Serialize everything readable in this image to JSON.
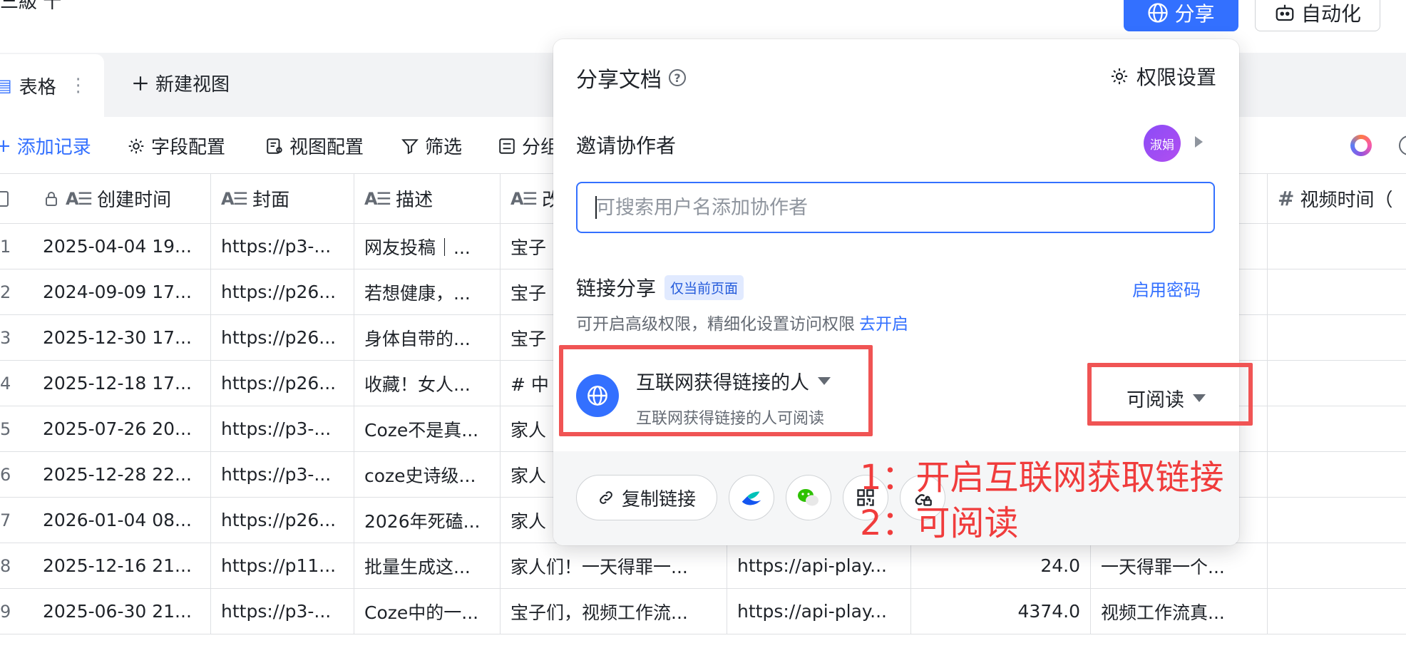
{
  "topbar": {
    "title_fragment": "三級  十",
    "share_label": "分享",
    "automation_label": "自动化"
  },
  "tabs": {
    "table_label": "表格",
    "more_glyph": "⋮",
    "new_view_label": "新建视图"
  },
  "toolbar": {
    "add_record": "添加记录",
    "field_config": "字段配置",
    "view_config": "视图配置",
    "filter": "筛选",
    "group_partial": "分组"
  },
  "grid": {
    "headers": [
      "创建时间",
      "封面",
      "描述",
      "改",
      "",
      "",
      "",
      "视频时间（"
    ],
    "rows": [
      {
        "idx": "1",
        "created": "2025-04-04 19...",
        "cover": "https://p3-...",
        "desc": "网友投稿｜...",
        "c4": "宝子",
        "c5": "",
        "c6": "",
        "c7": ""
      },
      {
        "idx": "2",
        "created": "2024-09-09 17...",
        "cover": "https://p26...",
        "desc": "若想健康，...",
        "c4": "宝子",
        "c5": "",
        "c6": "",
        "c7": ""
      },
      {
        "idx": "3",
        "created": "2025-12-30 17...",
        "cover": "https://p26...",
        "desc": "身体自带的...",
        "c4": "宝子",
        "c5": "",
        "c6": "",
        "c7": ""
      },
      {
        "idx": "4",
        "created": "2025-12-18 17...",
        "cover": "https://p26...",
        "desc": "收藏！女人...",
        "c4": "# 中",
        "c5": "",
        "c6": "",
        "c7": ""
      },
      {
        "idx": "5",
        "created": "2025-07-26 20...",
        "cover": "https://p3-...",
        "desc": "Coze不是真...",
        "c4": "家人",
        "c5": "",
        "c6": "",
        "c7": ""
      },
      {
        "idx": "6",
        "created": "2025-12-28 22...",
        "cover": "https://p3-...",
        "desc": "coze史诗级...",
        "c4": "家人",
        "c5": "",
        "c6": "",
        "c7": ""
      },
      {
        "idx": "7",
        "created": "2026-01-04 08...",
        "cover": "https://p26...",
        "desc": "2026年死磕...",
        "c4": "家人",
        "c5": "",
        "c6": "",
        "c7": ""
      },
      {
        "idx": "8",
        "created": "2025-12-16 21...",
        "cover": "https://p11...",
        "desc": "批量生成这...",
        "c4": "家人们！一天得罪一...",
        "c5": "https://api-play...",
        "c6": "24.0",
        "c7": "一天得罪一个..."
      },
      {
        "idx": "9",
        "created": "2025-06-30 21...",
        "cover": "https://p3-...",
        "desc": "Coze中的一...",
        "c4": "宝子们，视频工作流...",
        "c5": "https://api-play...",
        "c6": "4374.0",
        "c7": "视频工作流真..."
      }
    ]
  },
  "share": {
    "title": "分享文档",
    "help_glyph": "?",
    "permission_settings": "权限设置",
    "invite_label": "邀请协作者",
    "avatar_text": "淑娟",
    "search_placeholder": "可搜索用户名添加协作者",
    "link_share_label": "链接分享",
    "current_page_badge": "仅当前页面",
    "enable_password": "启用密码",
    "advanced_tip": "可开启高级权限，精细化设置访问权限",
    "go_enable": "去开启",
    "scope_title": "互联网获得链接的人",
    "scope_subtitle": "互联网获得链接的人可阅读",
    "access_level": "可阅读",
    "copy_link": "复制链接"
  },
  "annotations": {
    "step1": "1：开启互联网获取链接",
    "step2": "2：可阅读",
    "color": "#f05454"
  },
  "colors": {
    "primary": "#3370ff",
    "border": "#dee0e3",
    "text": "#1f2329",
    "muted": "#646a73"
  }
}
